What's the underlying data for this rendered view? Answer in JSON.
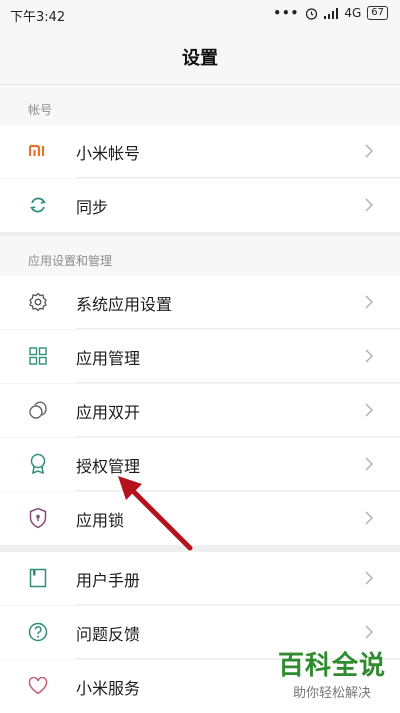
{
  "status_bar": {
    "time": "下午3:42",
    "dots": "•••",
    "network": "4G",
    "battery": "67"
  },
  "header": {
    "title": "设置"
  },
  "sections": [
    {
      "header": "帐号"
    },
    {
      "header": "应用设置和管理"
    }
  ],
  "items": [
    {
      "label": "小米帐号",
      "icon": "mi-logo-icon"
    },
    {
      "label": "同步",
      "icon": "sync-icon"
    },
    {
      "label": "系统应用设置",
      "icon": "gear-icon"
    },
    {
      "label": "应用管理",
      "icon": "grid-icon"
    },
    {
      "label": "应用双开",
      "icon": "dual-app-icon"
    },
    {
      "label": "授权管理",
      "icon": "award-icon"
    },
    {
      "label": "应用锁",
      "icon": "shield-lock-icon"
    },
    {
      "label": "用户手册",
      "icon": "book-icon"
    },
    {
      "label": "问题反馈",
      "icon": "help-icon"
    },
    {
      "label": "小米服务",
      "icon": "heart-icon"
    }
  ],
  "colors": {
    "accent": "#e8742b",
    "teal": "#2f8f7c",
    "arrow": "#b5121b"
  },
  "watermark": {
    "title": "百科全说",
    "subtitle": "助你轻松解决"
  }
}
